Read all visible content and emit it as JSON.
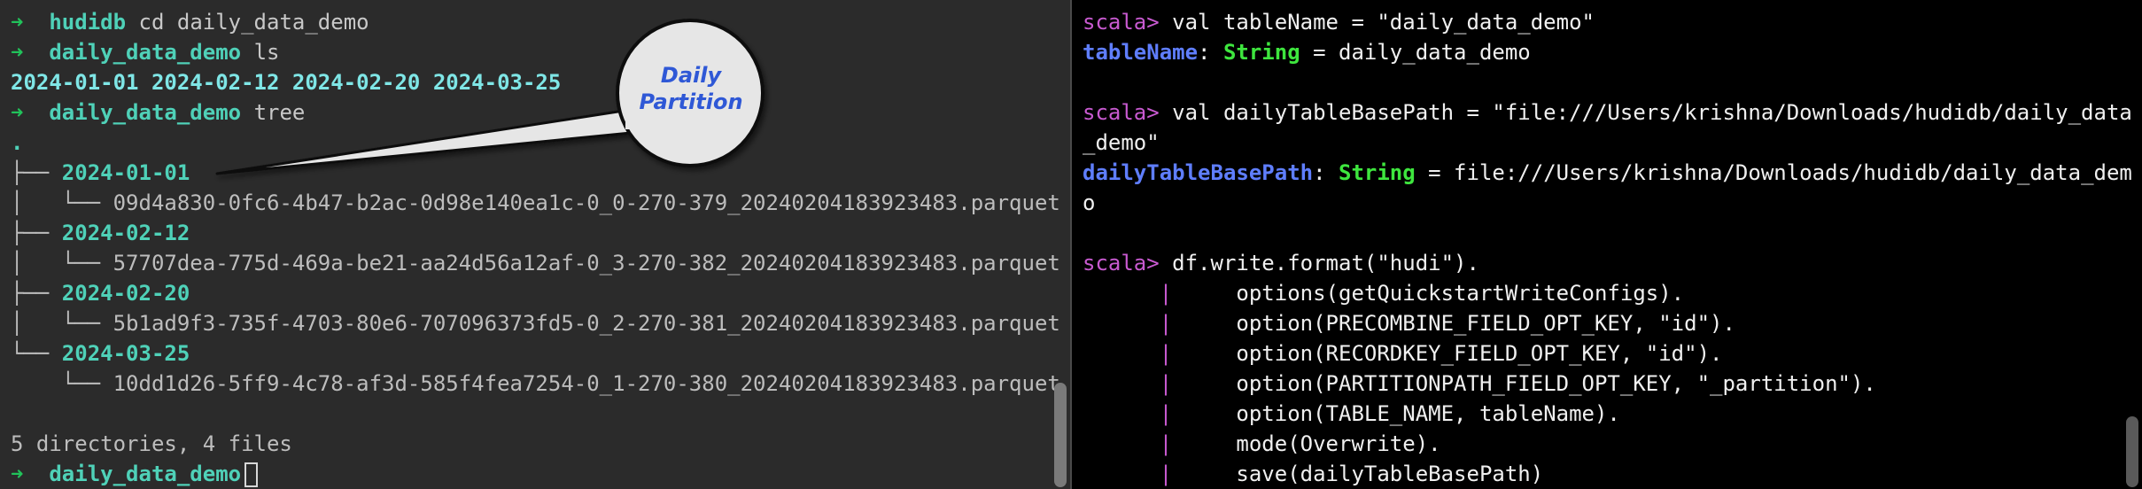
{
  "left_terminal": {
    "top_partial": "+",
    "line1": {
      "prompt_arrow": "➜",
      "dir": "hudidb",
      "cmd": "cd daily_data_demo"
    },
    "line2": {
      "prompt_arrow": "➜",
      "dir": "daily_data_demo",
      "cmd": "ls"
    },
    "ls_output": "2024-01-01 2024-02-12 2024-02-20 2024-03-25",
    "line3": {
      "prompt_arrow": "➜",
      "dir": "daily_data_demo",
      "cmd": "tree"
    },
    "tree_root": ".",
    "tree": [
      {
        "branch": "├── ",
        "folder": "2024-01-01",
        "file_branch": "│   └── ",
        "file": "09d4a830-0fc6-4b47-b2ac-0d98e140ea1c-0_0-270-379_20240204183923483.parquet"
      },
      {
        "branch": "├── ",
        "folder": "2024-02-12",
        "file_branch": "│   └── ",
        "file": "57707dea-775d-469a-be21-aa24d56a12af-0_3-270-382_20240204183923483.parquet"
      },
      {
        "branch": "├── ",
        "folder": "2024-02-20",
        "file_branch": "│   └── ",
        "file": "5b1ad9f3-735f-4703-80e6-707096373fd5-0_2-270-381_20240204183923483.parquet"
      },
      {
        "branch": "└── ",
        "folder": "2024-03-25",
        "file_branch": "    └── ",
        "file": "10dd1d26-5ff9-4c78-af3d-585f4fea7254-0_1-270-380_20240204183923483.parquet"
      }
    ],
    "summary": "5 directories, 4 files",
    "line_last": {
      "prompt_arrow": "➜",
      "dir": "daily_data_demo"
    }
  },
  "callout": {
    "line1": "Daily",
    "line2": "Partition"
  },
  "right_terminal": {
    "l1_prompt": "scala>",
    "l1_code": " val tableName = \"daily_data_demo\"",
    "l2_ident": "tableName",
    "l2_colon": ": ",
    "l2_type": "String",
    "l2_rest": " = daily_data_demo",
    "l3_prompt": "scala>",
    "l3_code": " val dailyTableBasePath = \"file:///Users/krishna/Downloads/hudidb/daily_data",
    "l3_wrap": "_demo\"",
    "l4_ident": "dailyTableBasePath",
    "l4_colon": ": ",
    "l4_type": "String",
    "l4_rest": " = file:///Users/krishna/Downloads/hudidb/daily_data_dem",
    "l4_wrap": "o",
    "l5_prompt": "scala>",
    "l5_code": " df.write.format(\"hudi\").",
    "cont_pipe": "|",
    "cont_lines": [
      "options(getQuickstartWriteConfigs).",
      "option(PRECOMBINE_FIELD_OPT_KEY, \"id\").",
      "option(RECORDKEY_FIELD_OPT_KEY, \"id\").",
      "option(PARTITIONPATH_FIELD_OPT_KEY, \"_partition\").",
      "option(TABLE_NAME, tableName).",
      "mode(Overwrite).",
      "save(dailyTableBasePath)"
    ]
  }
}
